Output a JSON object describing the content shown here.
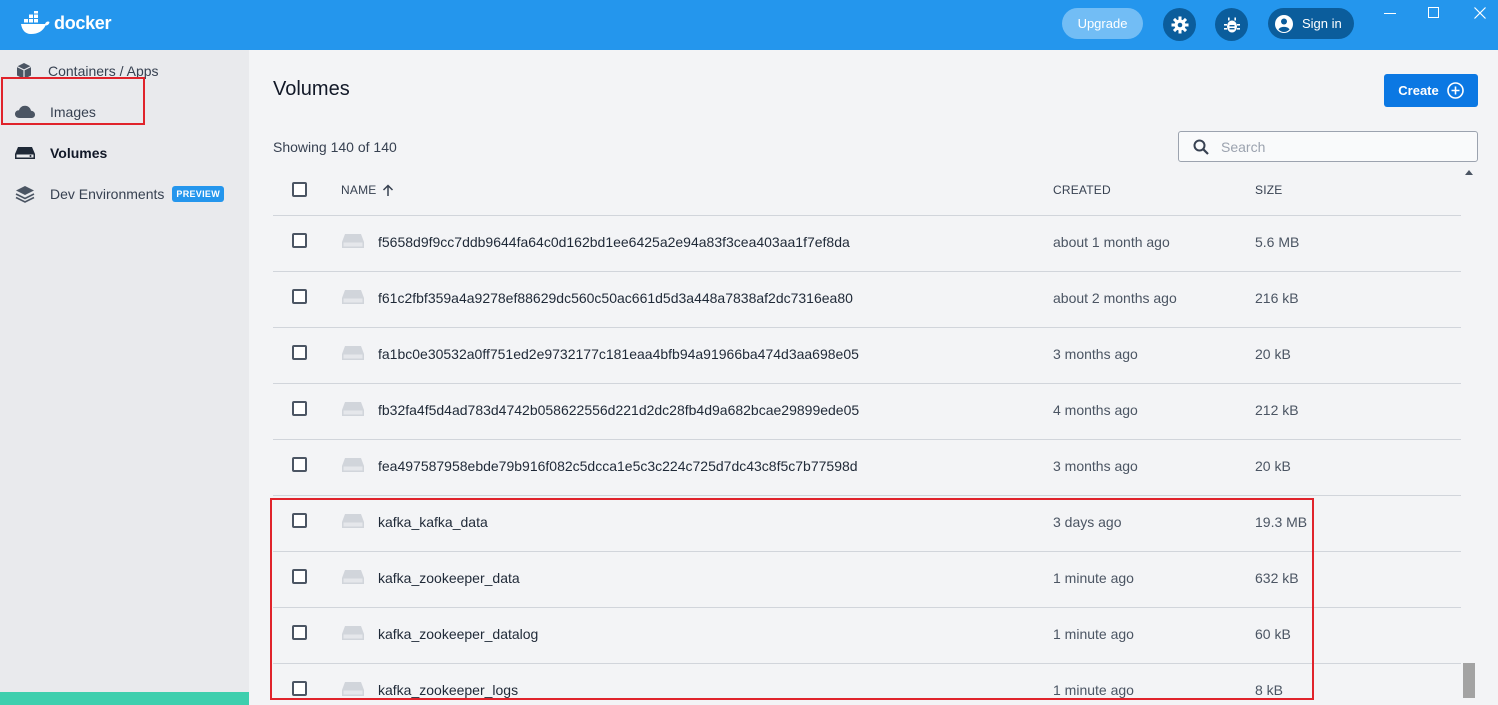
{
  "header": {
    "logo_text": "docker",
    "upgrade_label": "Upgrade",
    "signin_label": "Sign in"
  },
  "sidebar": {
    "items": [
      {
        "label": "Containers / Apps",
        "icon": "cube-icon"
      },
      {
        "label": "Images",
        "icon": "cloud-icon"
      },
      {
        "label": "Volumes",
        "icon": "hard-drive-icon",
        "active": true
      },
      {
        "label": "Dev Environments",
        "icon": "layers-icon",
        "badge": "PREVIEW"
      }
    ]
  },
  "main": {
    "title": "Volumes",
    "create_label": "Create",
    "showing": "Showing 140 of 140",
    "search_placeholder": "Search"
  },
  "table": {
    "columns": {
      "name": "NAME",
      "created": "CREATED",
      "size": "SIZE"
    },
    "rows": [
      {
        "name": "f5658d9f9cc7ddb9644fa64c0d162bd1ee6425a2e94a83f3cea403aa1f7ef8da",
        "created": "about 1 month ago",
        "size": "5.6 MB"
      },
      {
        "name": "f61c2fbf359a4a9278ef88629dc560c50ac661d5d3a448a7838af2dc7316ea80",
        "created": "about 2 months ago",
        "size": "216 kB"
      },
      {
        "name": "fa1bc0e30532a0ff751ed2e9732177c181eaa4bfb94a91966ba474d3aa698e05",
        "created": "3 months ago",
        "size": "20 kB"
      },
      {
        "name": "fb32fa4f5d4ad783d4742b058622556d221d2dc28fb4d9a682bcae29899ede05",
        "created": "4 months ago",
        "size": "212 kB"
      },
      {
        "name": "fea497587958ebde79b916f082c5dcca1e5c3c224c725d7dc43c8f5c7b77598d",
        "created": "3 months ago",
        "size": "20 kB"
      },
      {
        "name": "kafka_kafka_data",
        "created": "3 days ago",
        "size": "19.3 MB"
      },
      {
        "name": "kafka_zookeeper_data",
        "created": "1 minute ago",
        "size": "632 kB"
      },
      {
        "name": "kafka_zookeeper_datalog",
        "created": "1 minute ago",
        "size": "60 kB"
      },
      {
        "name": "kafka_zookeeper_logs",
        "created": "1 minute ago",
        "size": "8 kB"
      }
    ]
  }
}
